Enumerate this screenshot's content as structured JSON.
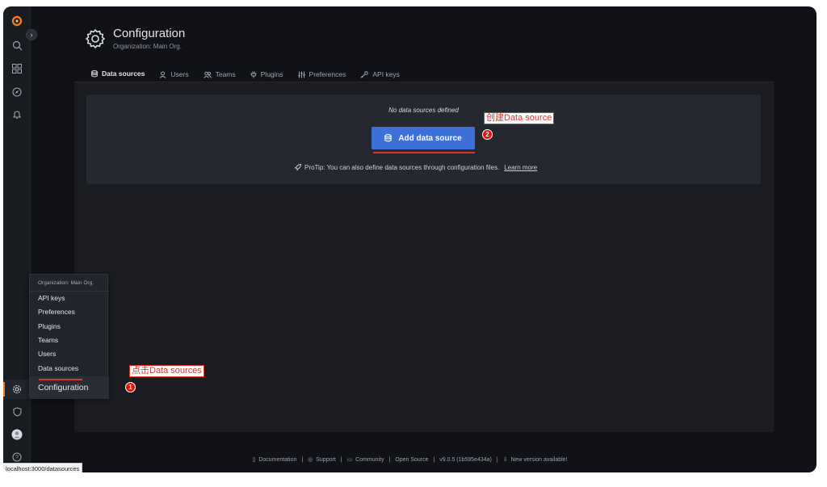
{
  "header": {
    "title": "Configuration",
    "subtitle": "Organization: Main Org."
  },
  "tabs": [
    {
      "label": "Data sources",
      "icon": "database-icon"
    },
    {
      "label": "Users",
      "icon": "user-icon"
    },
    {
      "label": "Teams",
      "icon": "users-icon"
    },
    {
      "label": "Plugins",
      "icon": "plug-icon"
    },
    {
      "label": "Preferences",
      "icon": "sliders-icon"
    },
    {
      "label": "API keys",
      "icon": "key-icon"
    }
  ],
  "empty_state": {
    "message": "No data sources defined",
    "button_label": "Add data source",
    "protip": "ProTip: You can also define data sources through configuration files.",
    "learn_more": "Learn more"
  },
  "annotations": {
    "create_label": "创建Data source",
    "create_number": "2",
    "click_label": "点击Data sources",
    "click_number": "1"
  },
  "config_menu": {
    "org": "Organization: Main Org.",
    "items": [
      "API keys",
      "Preferences",
      "Plugins",
      "Teams",
      "Users",
      "Data sources"
    ],
    "title": "Configuration"
  },
  "footer": {
    "documentation": "Documentation",
    "support": "Support",
    "community": "Community",
    "open_source": "Open Source",
    "version": "v9.0.5 (1b595e434a)",
    "new_version": "New version available!",
    "separator": "|"
  },
  "status_url": "localhost:3000/datasources",
  "colors": {
    "accent": "#f27a24",
    "primary_button": "#3d71d9",
    "annotation": "#e0312b"
  }
}
